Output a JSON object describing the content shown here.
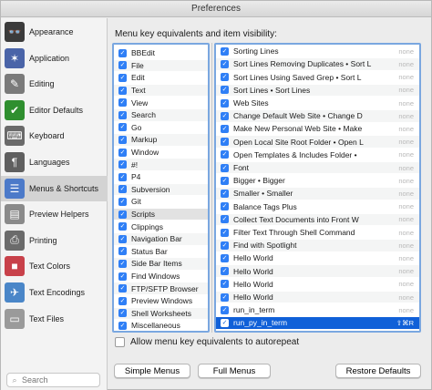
{
  "window": {
    "title": "Preferences"
  },
  "sidebar": {
    "items": [
      {
        "label": "Appearance",
        "icon": "glasses-face-icon",
        "glyph": "👓",
        "color": "#3b3b3b"
      },
      {
        "label": "Application",
        "icon": "app-icon",
        "glyph": "✶",
        "color": "#4a64a8"
      },
      {
        "label": "Editing",
        "icon": "pencil-icon",
        "glyph": "✎",
        "color": "#7a7a7a"
      },
      {
        "label": "Editor Defaults",
        "icon": "editor-defaults-icon",
        "glyph": "✔",
        "color": "#2f8f2f"
      },
      {
        "label": "Keyboard",
        "icon": "keyboard-icon",
        "glyph": "⌨",
        "color": "#6a6a6a"
      },
      {
        "label": "Languages",
        "icon": "languages-icon",
        "glyph": "¶",
        "color": "#5f5f5f"
      },
      {
        "label": "Menus & Shortcuts",
        "icon": "menus-icon",
        "glyph": "☰",
        "color": "#4c7ac9"
      },
      {
        "label": "Preview Helpers",
        "icon": "preview-icon",
        "glyph": "▤",
        "color": "#8a8a8a"
      },
      {
        "label": "Printing",
        "icon": "printer-icon",
        "glyph": "⎙",
        "color": "#6b6b6b"
      },
      {
        "label": "Text Colors",
        "icon": "text-colors-icon",
        "glyph": "■",
        "color": "#c8414a"
      },
      {
        "label": "Text Encodings",
        "icon": "text-encodings-icon",
        "glyph": "✈",
        "color": "#4a86c8"
      },
      {
        "label": "Text Files",
        "icon": "text-files-icon",
        "glyph": "▭",
        "color": "#9a9a9a"
      }
    ],
    "selected_index": 6,
    "search_placeholder": "Search"
  },
  "heading": "Menu key equivalents and item visibility:",
  "menus": [
    "BBEdit",
    "File",
    "Edit",
    "Text",
    "View",
    "Search",
    "Go",
    "Markup",
    "Window",
    "#!",
    "P4",
    "Subversion",
    "Git",
    "Scripts",
    "Clippings",
    "Navigation Bar",
    "Status Bar",
    "Side Bar Items",
    "Find Windows",
    "FTP/SFTP Browser",
    "Preview Windows",
    "Shell Worksheets",
    "Miscellaneous"
  ],
  "highlighted_menu_index": 13,
  "items": [
    {
      "label": "Sorting Lines",
      "key": "none"
    },
    {
      "label": "Sort Lines Removing Duplicates • Sort L",
      "key": "none"
    },
    {
      "label": "Sort Lines Using Saved Grep • Sort L",
      "key": "none"
    },
    {
      "label": "Sort Lines • Sort Lines",
      "key": "none"
    },
    {
      "label": "Web Sites",
      "key": "none"
    },
    {
      "label": "Change Default Web Site • Change D",
      "key": "none"
    },
    {
      "label": "Make New Personal Web Site • Make",
      "key": "none"
    },
    {
      "label": "Open Local Site Root Folder • Open L",
      "key": "none"
    },
    {
      "label": "Open Templates & Includes Folder •",
      "key": "none"
    },
    {
      "label": "Font",
      "key": "none"
    },
    {
      "label": "Bigger • Bigger",
      "key": "none"
    },
    {
      "label": "Smaller • Smaller",
      "key": "none"
    },
    {
      "label": "Balance Tags Plus",
      "key": "none"
    },
    {
      "label": "Collect Text Documents into Front W",
      "key": "none"
    },
    {
      "label": "Filter Text Through Shell Command",
      "key": "none"
    },
    {
      "label": "Find with Spotlight",
      "key": "none"
    },
    {
      "label": "Hello World",
      "key": "none"
    },
    {
      "label": "Hello World",
      "key": "none"
    },
    {
      "label": "Hello World",
      "key": "none"
    },
    {
      "label": "Hello World",
      "key": "none"
    },
    {
      "label": "run_in_term",
      "key": "none"
    },
    {
      "label": "run_py_in_term",
      "key": "⇧⌘R"
    }
  ],
  "selected_item_index": 21,
  "option": {
    "label": "Allow menu key equivalents to autorepeat",
    "checked": false
  },
  "buttons": {
    "simple": "Simple Menus",
    "full": "Full Menus",
    "restore": "Restore Defaults"
  },
  "colors": {
    "selection": "#1060d8",
    "checkbox": "#2f7ff6",
    "focus_ring": "#7aa7e0"
  }
}
